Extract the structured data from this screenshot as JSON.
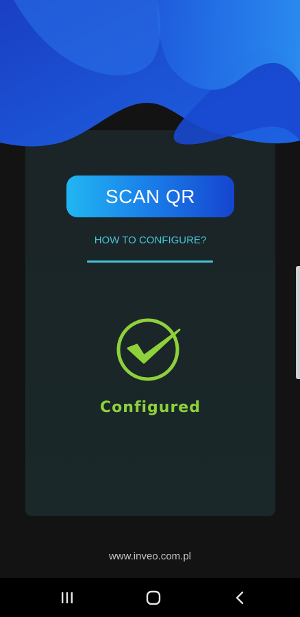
{
  "colors": {
    "background": "#131313",
    "card": "#1b2426",
    "scan_button_gradient": [
      "#21b6f2",
      "#1a7de9",
      "#1545cf"
    ],
    "link": "#47c6d9",
    "success": "#8ed13b",
    "wave_primary": "#1f54d6",
    "wave_secondary": "#2a8ef0"
  },
  "header": {
    "decoration": "blue-wave-shape"
  },
  "main": {
    "scan_button_label": "SCAN QR",
    "how_to_configure_label": "HOW TO CONFIGURE?",
    "status_icon": "check-circle-icon",
    "status_text": "Configured"
  },
  "footer": {
    "website": "www.inveo.com.pl"
  },
  "navbar": {
    "recent_icon": "recent-apps-icon",
    "home_icon": "home-icon",
    "back_icon": "back-icon"
  }
}
